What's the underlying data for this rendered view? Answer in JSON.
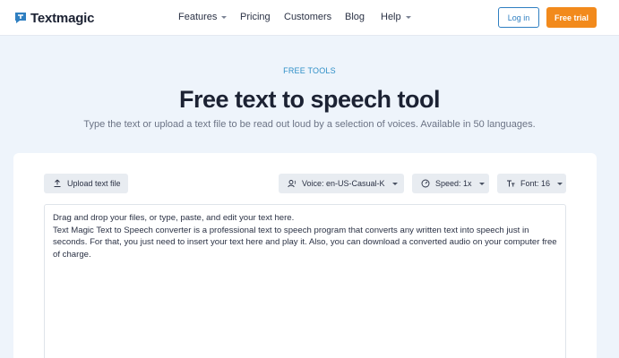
{
  "brand": {
    "name": "Textmagic",
    "color": "#2f7fc1"
  },
  "nav": {
    "items": [
      {
        "label": "Features",
        "dropdown": true
      },
      {
        "label": "Pricing",
        "dropdown": false
      },
      {
        "label": "Customers",
        "dropdown": false
      },
      {
        "label": "Blog",
        "dropdown": false
      },
      {
        "label": "Help",
        "dropdown": true
      }
    ],
    "login_label": "Log in",
    "trial_label": "Free trial"
  },
  "hero": {
    "eyebrow": "FREE TOOLS",
    "title": "Free text to speech tool",
    "subtitle": "Type the text or upload a text file to be read out loud by a selection of voices. Available in 50 languages."
  },
  "toolbar": {
    "upload_label": "Upload text file",
    "voice_label": "Voice: en-US-Casual-K",
    "speed_label": "Speed: 1x",
    "font_label": "Font: 16"
  },
  "editor": {
    "line1": "Drag and drop your files, or type, paste, and edit your text here.",
    "line2": "Text Magic Text to Speech converter is a professional text to speech program that converts any written text into speech just in seconds. For that, you just need to insert your text here and play it. Also, you can download a converted audio on your computer free of charge."
  },
  "colors": {
    "accent": "#2f7fc1",
    "cta": "#f28a1c",
    "page_bg": "#eef4fb"
  },
  "icons": {
    "upload": "upload-icon",
    "voice": "voice-icon",
    "speed": "speedometer-icon",
    "font": "font-size-icon"
  }
}
